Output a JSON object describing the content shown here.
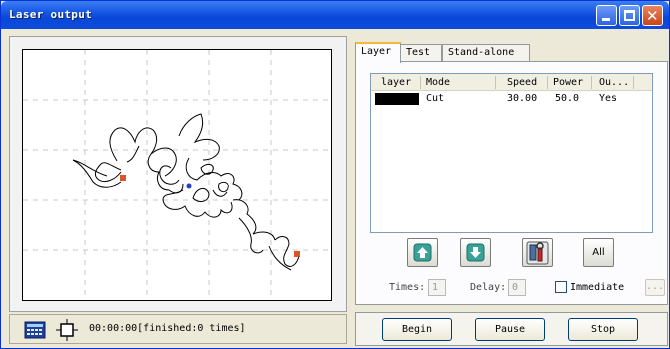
{
  "window": {
    "title": "Laser output"
  },
  "tabs": [
    {
      "label": "Layer"
    },
    {
      "label": "Test"
    },
    {
      "label": "Stand-alone"
    }
  ],
  "layer_table": {
    "headers": [
      "layer",
      "Mode",
      "Speed",
      "Power",
      "Ou..."
    ],
    "rows": [
      {
        "color": "#000000",
        "mode": "Cut",
        "speed": "30.00",
        "power": "50.0",
        "output": "Yes"
      }
    ]
  },
  "actions": {
    "all_label": "All"
  },
  "options": {
    "times_label": "Times:",
    "times_value": "1",
    "delay_label": "Delay:",
    "delay_value": "0",
    "immediate_label": "Immediate",
    "more_label": "..."
  },
  "status": {
    "text": "00:00:00[finished:0 times]"
  },
  "controls": {
    "begin": "Begin",
    "pause": "Pause",
    "stop": "Stop"
  },
  "colors": {
    "title_bar": "#0a47d6",
    "tab_highlight": "#f6b73c"
  }
}
